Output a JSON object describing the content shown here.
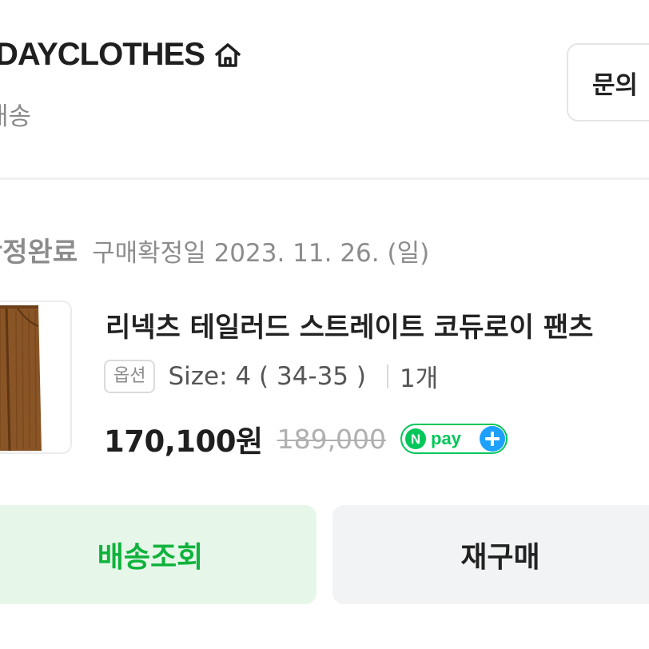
{
  "store": {
    "name": "DAYCLOTHES",
    "home_icon": "home-icon",
    "delivery_label": "배송"
  },
  "inquiry_button_label": "문의",
  "order": {
    "status": "확정완료",
    "confirm_date": "구매확정일 2023. 11. 26. (일)"
  },
  "product": {
    "name": "리넥츠 테일러드 스트레이트 코듀로이 팬츠",
    "option_badge": "옵션",
    "option_value": "Size: 4 ( 34-35 )",
    "quantity": "1개",
    "sale_price": "170,100원",
    "original_price": "189,000",
    "payment_badge": "N pay +",
    "thumbnail_color": "#8a5526"
  },
  "actions": {
    "track_label": "배송조회",
    "reorder_label": "재구매"
  },
  "colors": {
    "accent_green": "#10b23c",
    "track_bg": "#e6f7ea",
    "npay_green": "#03c75a",
    "npay_plus_blue": "#1ea0ff"
  }
}
